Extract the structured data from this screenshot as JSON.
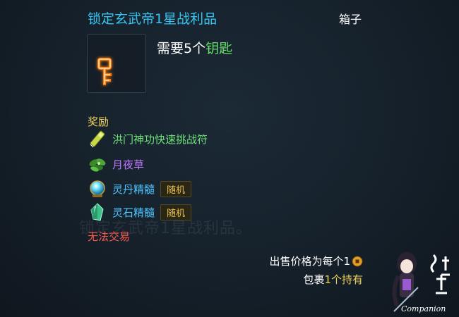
{
  "tooltip": {
    "title": "锁定玄武帝1星战利品",
    "category": "箱子",
    "requirement": {
      "prefix": "需要5个",
      "item": "钥匙"
    },
    "rewards_label": "奖励",
    "rewards": [
      {
        "name": "洪门神功快速挑战符",
        "color": "#6fe07a",
        "icon": "scroll-icon"
      },
      {
        "name": "月夜草",
        "color": "#c07aff",
        "icon": "herb-icon"
      },
      {
        "name": "灵丹精髓",
        "color": "#4fc4ff",
        "icon": "orb-icon",
        "tag": "随机"
      },
      {
        "name": "灵石精髓",
        "color": "#4fc4ff",
        "icon": "crystal-icon",
        "tag": "随机"
      }
    ],
    "untradeable": "无法交易",
    "sell_price": "出售价格为每个1",
    "bag": {
      "prefix": "包裹",
      "count": "1个持有"
    }
  },
  "ghost_text": "锁定玄武帝1星战利品。",
  "watermark": {
    "label": "Companion"
  }
}
